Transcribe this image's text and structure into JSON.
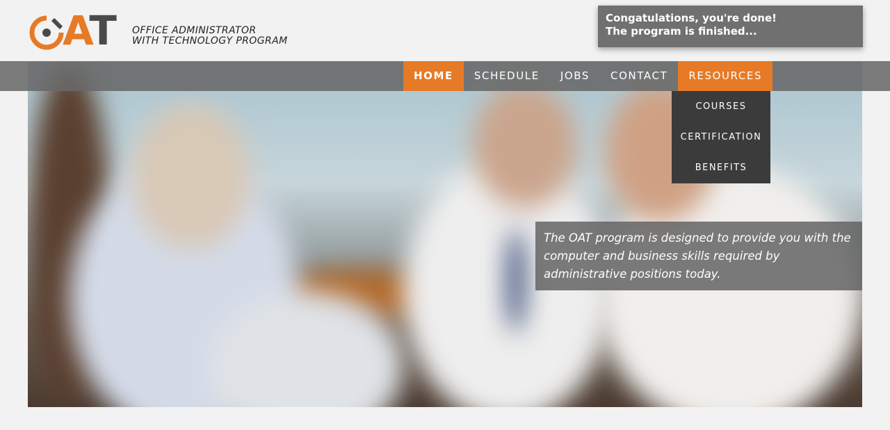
{
  "logo": {
    "letters": {
      "a": "A",
      "t": "T"
    },
    "line1": "OFFICE ADMINISTRATOR",
    "line2": "WITH TECHNOLOGY PROGRAM",
    "colors": {
      "orange": "#e67a26",
      "dark": "#4a4a4a"
    }
  },
  "toast": {
    "line1": "Congatulations, you're done!",
    "line2": "The program is finished..."
  },
  "nav": {
    "items": [
      {
        "label": "HOME"
      },
      {
        "label": "SCHEDULE"
      },
      {
        "label": "JOBS"
      },
      {
        "label": "CONTACT"
      },
      {
        "label": "RESOURCES"
      }
    ],
    "dropdown": [
      {
        "label": "COURSES"
      },
      {
        "label": "CERTIFICATION"
      },
      {
        "label": "BENEFITS"
      }
    ]
  },
  "hero": {
    "caption": "The OAT program is designed to provide you with the computer and business skills required by administrative positions today."
  },
  "colors": {
    "accent": "#e67a26",
    "navbar": "#696969",
    "dropdown": "#3b3b3b"
  }
}
